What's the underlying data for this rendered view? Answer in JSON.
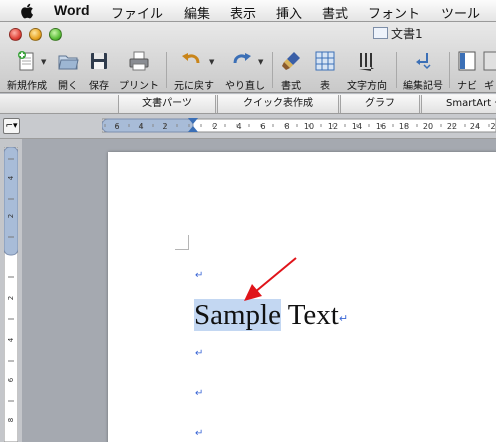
{
  "menubar": {
    "app_name": "Word",
    "items": [
      "ファイル",
      "編集",
      "表示",
      "挿入",
      "書式",
      "フォント",
      "ツール"
    ]
  },
  "window": {
    "title": "文書1"
  },
  "toolbar": {
    "buttons": [
      {
        "label": "新規作成",
        "icon": "new-document-icon"
      },
      {
        "label": "開く",
        "icon": "open-folder-icon"
      },
      {
        "label": "保存",
        "icon": "save-disk-icon"
      },
      {
        "label": "プリント",
        "icon": "printer-icon"
      },
      {
        "label": "元に戻す",
        "icon": "undo-icon"
      },
      {
        "label": "やり直し",
        "icon": "redo-icon"
      },
      {
        "label": "書式",
        "icon": "format-brush-icon"
      },
      {
        "label": "表",
        "icon": "table-grid-icon"
      },
      {
        "label": "文字方向",
        "icon": "text-direction-icon"
      },
      {
        "label": "編集記号",
        "icon": "paragraph-marks-icon"
      },
      {
        "label": "ナビ",
        "icon": "navigation-pane-icon"
      },
      {
        "label": "ギ",
        "icon": "gallery-icon"
      }
    ]
  },
  "ribbon": {
    "tabs": [
      "文書パーツ",
      "クイック表作成",
      "グラフ",
      "SmartArt グ"
    ]
  },
  "ruler": {
    "horizontal_labels": [
      "6",
      "4",
      "2",
      "2",
      "4",
      "6",
      "8",
      "10",
      "12",
      "14",
      "16",
      "18",
      "20",
      "22",
      "24",
      "2"
    ],
    "vertical_labels": [
      "4",
      "2",
      "2",
      "4",
      "6",
      "8"
    ]
  },
  "document": {
    "selected_text": "Sample",
    "rest_text": " Text",
    "paragraph_mark": "↵",
    "return_mark": "↵"
  },
  "colors": {
    "selection": "#c3d7f2",
    "arrow": "#e0141a",
    "paragraph_mark": "#3a66d6"
  }
}
